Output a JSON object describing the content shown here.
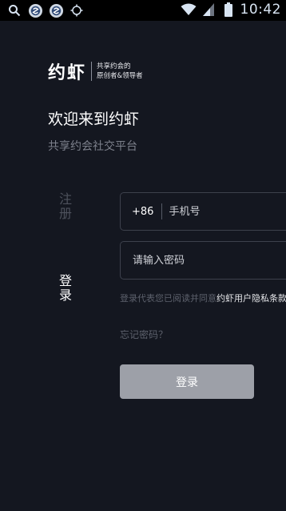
{
  "status_bar": {
    "time": "10:42",
    "icons": [
      "search-icon",
      "app-icon",
      "app-icon",
      "location-icon",
      "wifi-icon",
      "signal-icon",
      "battery-icon"
    ]
  },
  "brand": {
    "name": "约虾",
    "tagline_line1": "共享约会的",
    "tagline_line2": "原创者&领导者"
  },
  "welcome": {
    "title": "欢迎来到约虾",
    "subtitle": "共享约会社交平台"
  },
  "tabs": {
    "register": "注册",
    "login": "登录",
    "active": "login"
  },
  "form": {
    "country_code": "+86",
    "phone_placeholder": "手机号",
    "phone_value": "",
    "password_placeholder": "请输入密码",
    "password_value": ""
  },
  "agreement": {
    "prefix": "登录代表您已阅读并同意",
    "link": "约虾用户隐私条款"
  },
  "forgot_password": "忘记密码？",
  "login_button": "登录",
  "colors": {
    "background": "#141720",
    "button": "#9da0a8",
    "muted_text": "#5d616c"
  }
}
